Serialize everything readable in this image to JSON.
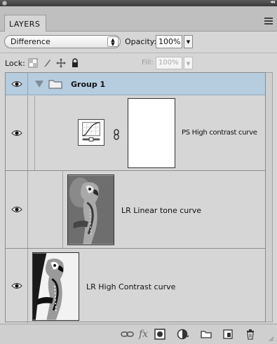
{
  "panel": {
    "tab_label": "LAYERS"
  },
  "blend": {
    "mode": "Difference",
    "opacity_label": "Opacity:",
    "opacity_value": "100%"
  },
  "lock": {
    "label": "Lock:",
    "fill_label": "Fill:",
    "fill_value": "100%"
  },
  "layers": {
    "group": {
      "name": "Group 1",
      "expanded": true,
      "selected": true
    },
    "adjustment": {
      "name": "PS High contrast curve",
      "type": "curves-adjustment"
    },
    "linear": {
      "name": "LR Linear tone curve"
    },
    "high": {
      "name": "LR High Contrast curve"
    }
  },
  "toolbar": {
    "fx_label": "fx",
    "icons": [
      "link-layers-icon",
      "add-layer-style-icon",
      "add-mask-icon",
      "new-adjustment-layer-icon",
      "new-group-icon",
      "new-layer-icon",
      "delete-layer-icon"
    ]
  },
  "colors": {
    "selected_row": "#b6cde0",
    "panel_bg": "#d6d6d6"
  }
}
